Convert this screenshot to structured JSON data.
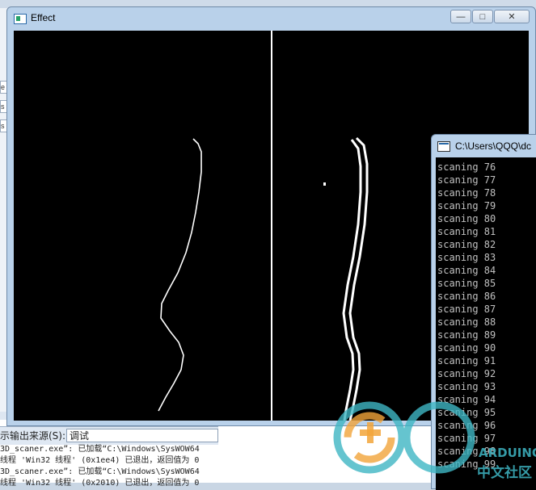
{
  "ide": {
    "side_tabs": [
      "e",
      "s",
      "s"
    ],
    "output": {
      "source_label": "示输出来源(S):",
      "source_value": "调试",
      "lines": [
        "3D_scaner.exe”: 已加载“C:\\Windows\\SysWOW64",
        "线程 'Win32 线程' (0x1ee4) 已退出，返回值为 0",
        "3D_scaner.exe”: 已加载“C:\\Windows\\SysWOW64",
        "线程 'Win32 线程' (0x2010) 已退出，返回值为 0"
      ]
    }
  },
  "effect_window": {
    "title": "Effect",
    "buttons": {
      "minimize": "—",
      "maximize": "□",
      "close": "✕"
    }
  },
  "console_window": {
    "title": "C:\\Users\\QQQ\\dc",
    "lines": [
      "scaning 76",
      "scaning 77",
      "scaning 78",
      "scaning 79",
      "scaning 80",
      "scaning 81",
      "scaning 82",
      "scaning 83",
      "scaning 84",
      "scaning 85",
      "scaning 86",
      "scaning 87",
      "scaning 88",
      "scaning 89",
      "scaning 90",
      "scaning 91",
      "scaning 92",
      "scaning 93",
      "scaning 94",
      "scaning 95",
      "scaning 96",
      "scaning 97",
      "scaning 98",
      "scaning 99"
    ]
  },
  "watermark": {
    "line1": "ARDUINO",
    "line2": "中文社区"
  },
  "colors": {
    "canvas": "#000000",
    "trace": "#ffffff",
    "console_text": "#c0c0c0",
    "watermark": "#3fb6c4"
  }
}
